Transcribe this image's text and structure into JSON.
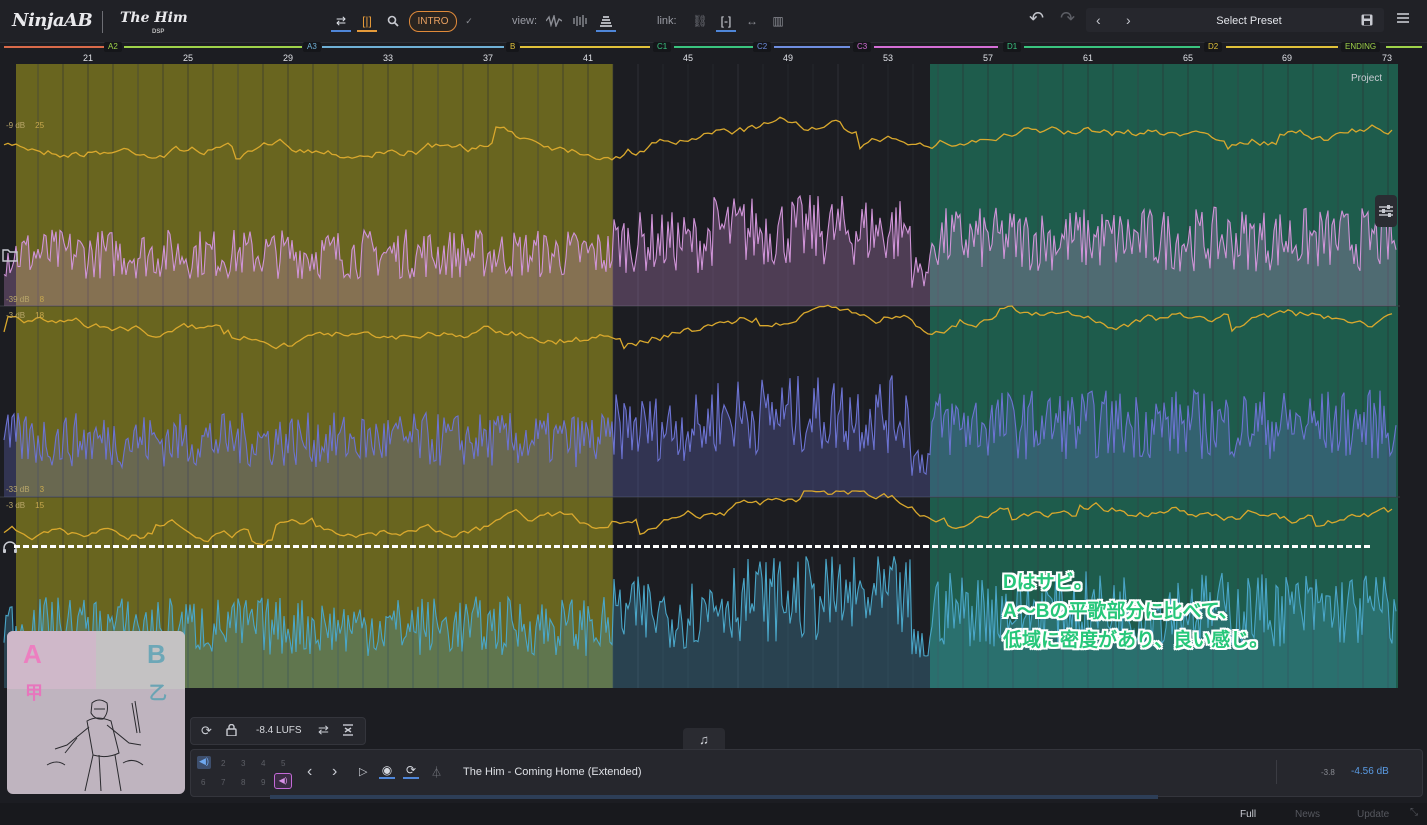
{
  "header": {
    "logo_left": "NinjaAB",
    "logo_right": "The Him",
    "logo_right_sub": "DSP",
    "intro_button": "INTRO",
    "check_mark": "✓",
    "view_label": "view:",
    "link_label": "link:",
    "preset_label": "Select Preset"
  },
  "colors": {
    "section_yellow": "#7f7a1f",
    "section_teal": "#1e6a56",
    "wave_pink": "#d094d8",
    "wave_blue": "#6c73d2",
    "wave_cyan": "#4aa6c8",
    "loudness_line": "#d9a82d",
    "annotation_green": "#27c77a"
  },
  "sections": [
    {
      "label": "A2",
      "color": "#9fd34a"
    },
    {
      "label": "A3",
      "color": "#6fb0d6"
    },
    {
      "label": "B",
      "color": "#e0c13a"
    },
    {
      "label": "C1",
      "color": "#3ac47f"
    },
    {
      "label": "C2",
      "color": "#6f8ee0"
    },
    {
      "label": "C3",
      "color": "#d46ed6"
    },
    {
      "label": "D1",
      "color": "#3ac47f"
    },
    {
      "label": "D2",
      "color": "#e0c13a"
    },
    {
      "label": "ENDING",
      "color": "#9fd34a"
    }
  ],
  "bar_numbers": [
    "21",
    "25",
    "29",
    "33",
    "37",
    "41",
    "45",
    "49",
    "53",
    "57",
    "61",
    "65",
    "69",
    "73"
  ],
  "project_label": "Project",
  "tracks": [
    {
      "db_top": "-9 dB",
      "num_top": "25",
      "db_bottom": "-39 dB",
      "num_bottom": "8"
    },
    {
      "db_top": "-3 dB",
      "num_top": "18",
      "db_bottom": "-33 dB",
      "num_bottom": "3"
    },
    {
      "db_top": "-3 dB",
      "num_top": "15"
    }
  ],
  "annotation": {
    "line1": "Dはサビ。",
    "line2": "A～Bの平歌部分に比べて、",
    "line3": "低域に密度があり、良い感じ。"
  },
  "ab_card": {
    "a_label": "A",
    "b_label": "B",
    "a_kanji": "甲",
    "b_kanji": "乙"
  },
  "controls": {
    "lufs": "-8.4 LUFS",
    "slots_top": [
      "2",
      "3",
      "4",
      "5"
    ],
    "slots_bottom": [
      "6",
      "7",
      "8",
      "9"
    ],
    "track_title": "The Him - Coming Home (Extended)",
    "level_small": "-3.8",
    "level_db": "-4.56 dB"
  },
  "icons": {
    "undo": "undo-icon",
    "redo": "redo-icon",
    "save": "save-icon",
    "menu": "hamburger-menu-icon",
    "folder": "folder-icon",
    "headphones": "headphones-icon",
    "sliders": "sliders-icon",
    "note": "music-note-icon"
  },
  "footer": {
    "full": "Full",
    "news": "News",
    "update": "Update"
  }
}
